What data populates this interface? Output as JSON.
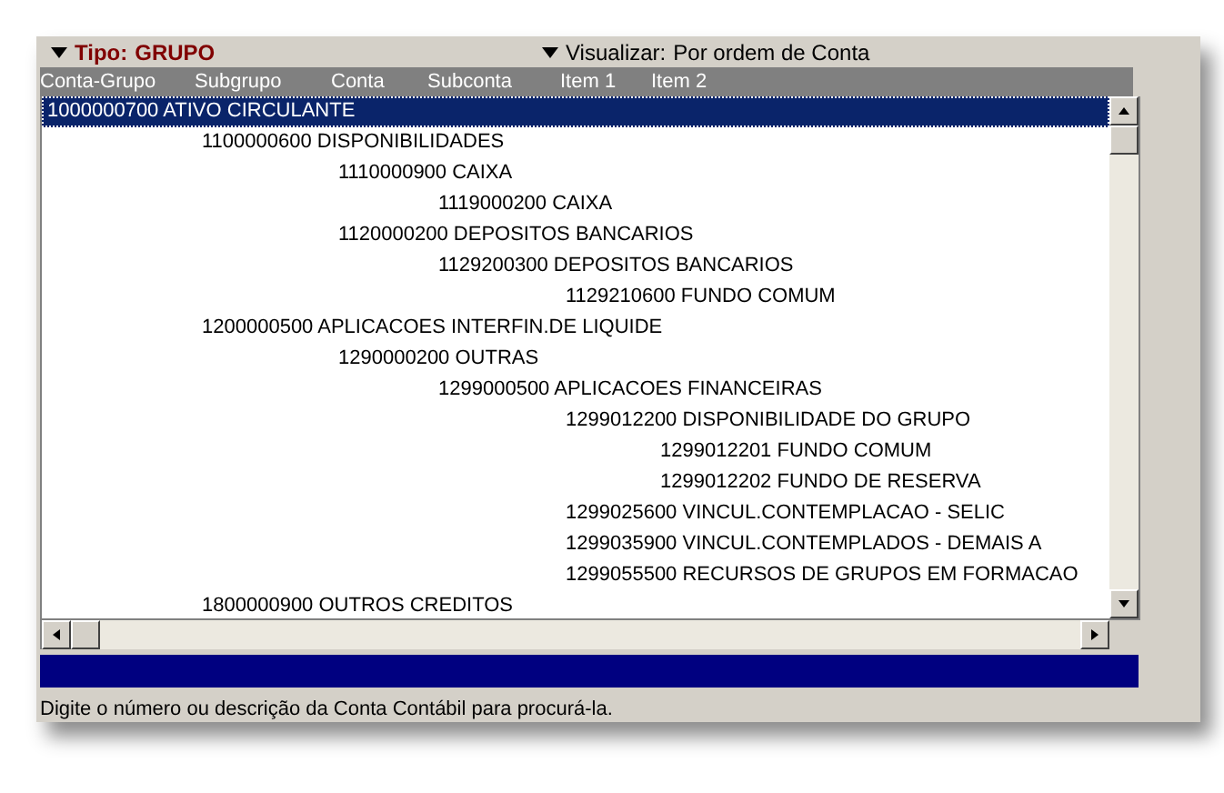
{
  "header": {
    "tipo_label": "Tipo:",
    "tipo_value": "GRUPO",
    "view_label": "Visualizar:",
    "view_value": "Por ordem de Conta"
  },
  "columns": [
    "Conta-Grupo",
    "Subgrupo",
    "Conta",
    "Subconta",
    "Item 1",
    "Item 2"
  ],
  "tree": [
    {
      "label": "1000000700 ATIVO CIRCULANTE",
      "selected": true,
      "children": [
        {
          "label": "1100000600 DISPONIBILIDADES",
          "selected": false,
          "children": [
            {
              "label": "1110000900 CAIXA",
              "selected": false,
              "children": [
                {
                  "label": "1119000200 CAIXA",
                  "selected": false
                }
              ]
            },
            {
              "label": "1120000200 DEPOSITOS BANCARIOS",
              "selected": false,
              "children": [
                {
                  "label": "1129200300 DEPOSITOS BANCARIOS",
                  "selected": false,
                  "children": [
                    {
                      "label": "1129210600 FUNDO COMUM",
                      "selected": false
                    }
                  ]
                }
              ]
            }
          ]
        },
        {
          "label": "1200000500 APLICACOES INTERFIN.DE LIQUIDE",
          "selected": false,
          "children": [
            {
              "label": "1290000200 OUTRAS",
              "selected": false,
              "children": [
                {
                  "label": "1299000500 APLICACOES FINANCEIRAS",
                  "selected": false,
                  "children": [
                    {
                      "label": "1299012200 DISPONIBILIDADE DO GRUPO",
                      "selected": false,
                      "children": [
                        {
                          "label": "1299012201 FUNDO COMUM",
                          "selected": false
                        },
                        {
                          "label": "1299012202 FUNDO DE RESERVA",
                          "selected": false
                        }
                      ]
                    },
                    {
                      "label": "1299025600 VINCUL.CONTEMPLACAO - SELIC",
                      "selected": false
                    },
                    {
                      "label": "1299035900 VINCUL.CONTEMPLADOS - DEMAIS A",
                      "selected": false
                    },
                    {
                      "label": "1299055500 RECURSOS DE GRUPOS EM FORMACAO",
                      "selected": false
                    }
                  ]
                }
              ]
            }
          ]
        },
        {
          "label": "1800000900 OUTROS CREDITOS",
          "selected": false
        }
      ]
    }
  ],
  "status": "Digite o número ou descrição da Conta Contábil para procurá-la."
}
